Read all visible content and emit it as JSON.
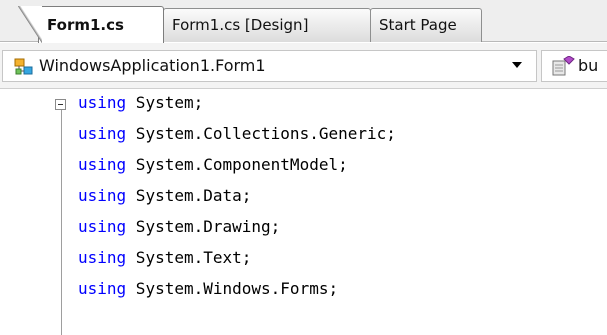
{
  "tabs": [
    {
      "label": "Form1.cs",
      "active": true
    },
    {
      "label": "Form1.cs [Design]",
      "active": false
    },
    {
      "label": "Start Page",
      "active": false
    }
  ],
  "navbar": {
    "class_dropdown": {
      "value": "WindowsApplication1.Form1",
      "icon": "class-icon"
    },
    "member_dropdown": {
      "value": "bu",
      "icon": "member-icon"
    }
  },
  "code": {
    "keyword_color": "#0000ff",
    "lines": [
      {
        "keyword": "using",
        "text": " System;"
      },
      {
        "keyword": "using",
        "text": " System.Collections.Generic;"
      },
      {
        "keyword": "using",
        "text": " System.ComponentModel;"
      },
      {
        "keyword": "using",
        "text": " System.Data;"
      },
      {
        "keyword": "using",
        "text": " System.Drawing;"
      },
      {
        "keyword": "using",
        "text": " System.Text;"
      },
      {
        "keyword": "using",
        "text": " System.Windows.Forms;"
      }
    ]
  }
}
